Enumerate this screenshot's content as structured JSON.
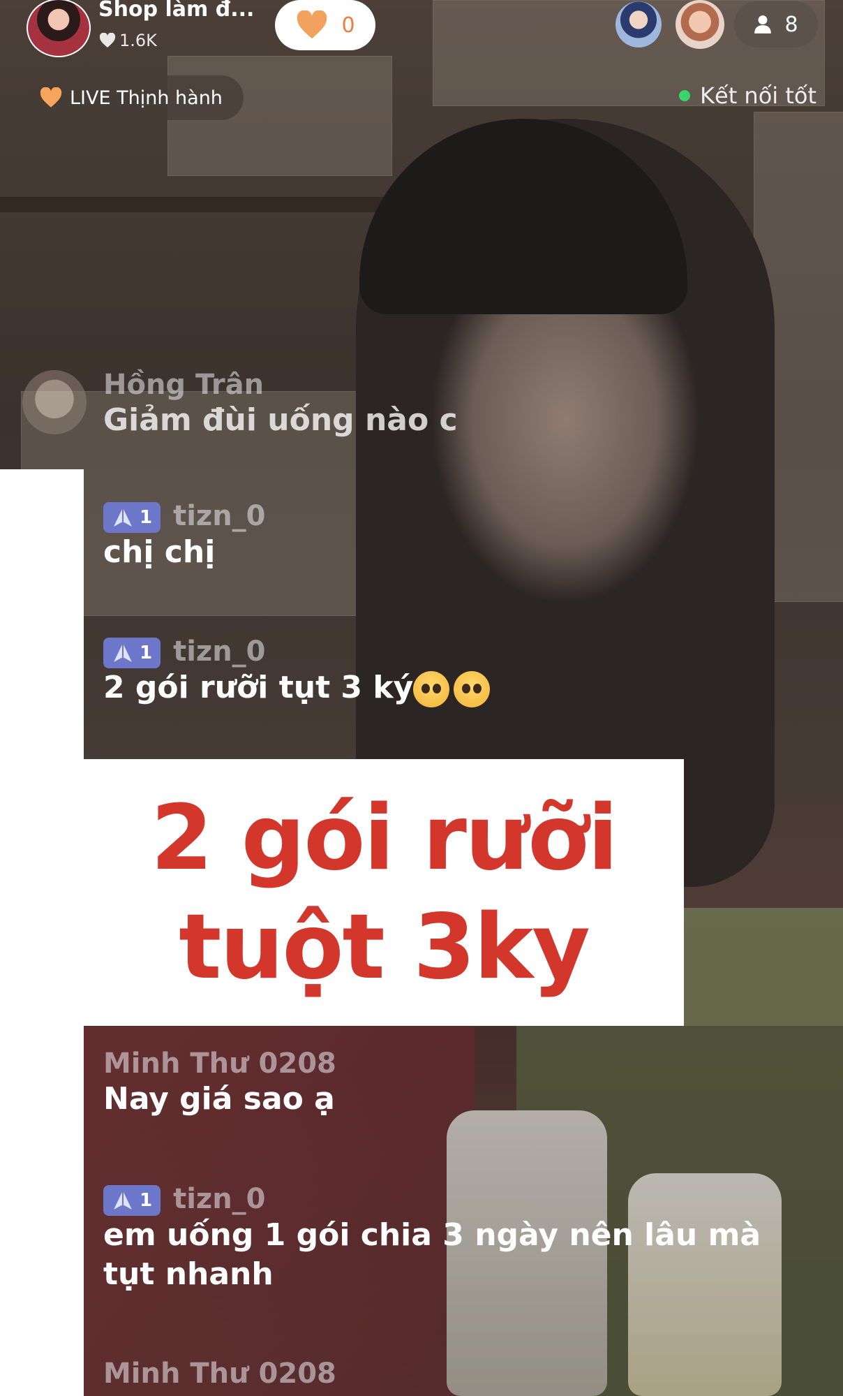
{
  "header": {
    "shop_name": "Shop làm đ...",
    "likes": "1.6K",
    "follow_count": "0",
    "viewer_count": "8"
  },
  "status": {
    "trending_label": "LIVE Thịnh hành",
    "connection_label": "Kết nối tốt"
  },
  "comments_top": [
    {
      "name": "Hồng Trân",
      "text": "Giảm đùi uống nào c"
    },
    {
      "badge": "1",
      "name": "tizn_0",
      "text": "chị chị"
    },
    {
      "badge": "1",
      "name": "tizn_0",
      "text": "2 gói rưỡi tụt 3 ký"
    }
  ],
  "overlay": {
    "line1": "2 gói rưỡi",
    "line2": "tuột 3ky"
  },
  "comments_bottom": [
    {
      "name": "Minh Thư 0208",
      "text": "Nay  giá sao ạ"
    },
    {
      "badge": "1",
      "name": "tizn_0",
      "text_line1": "em uống 1 gói chia 3 ngày nên lâu mà",
      "text_line2": "tụt nhanh"
    },
    {
      "name": "Minh Thư 0208"
    }
  ],
  "colors": {
    "overlay_text": "#d3362a",
    "badge": "#6c77c9",
    "follow_heart": "#ee7c3f",
    "connection_dot": "#3ad46a"
  }
}
